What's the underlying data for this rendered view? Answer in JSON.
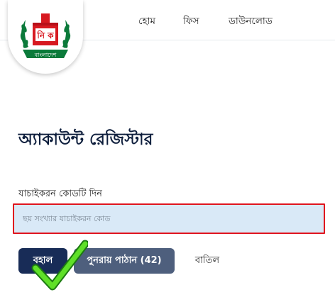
{
  "header": {
    "logo": {
      "icon": "election-commission-emblem",
      "text": "বাংলাদেশ",
      "colors": {
        "green": "#0b7a3a",
        "red": "#d71920"
      }
    },
    "nav": [
      {
        "label": "হোম"
      },
      {
        "label": "ফিস"
      },
      {
        "label": "ডাউনলোড"
      }
    ]
  },
  "main": {
    "title": "অ্যাকাউন্ট রেজিস্টার",
    "code_field": {
      "label": "যাচাইকরন কোডটি দিন",
      "placeholder": "ছয় সংখ্যার যাচাইকরন কোড",
      "value": ""
    },
    "buttons": {
      "submit": "বহাল",
      "resend": "পুনরায় পাঠান (42)",
      "cancel": "বাতিল"
    }
  },
  "overlay": {
    "checkmark_icon": "green-checkmark-icon",
    "highlight_color": "#e0141e"
  }
}
